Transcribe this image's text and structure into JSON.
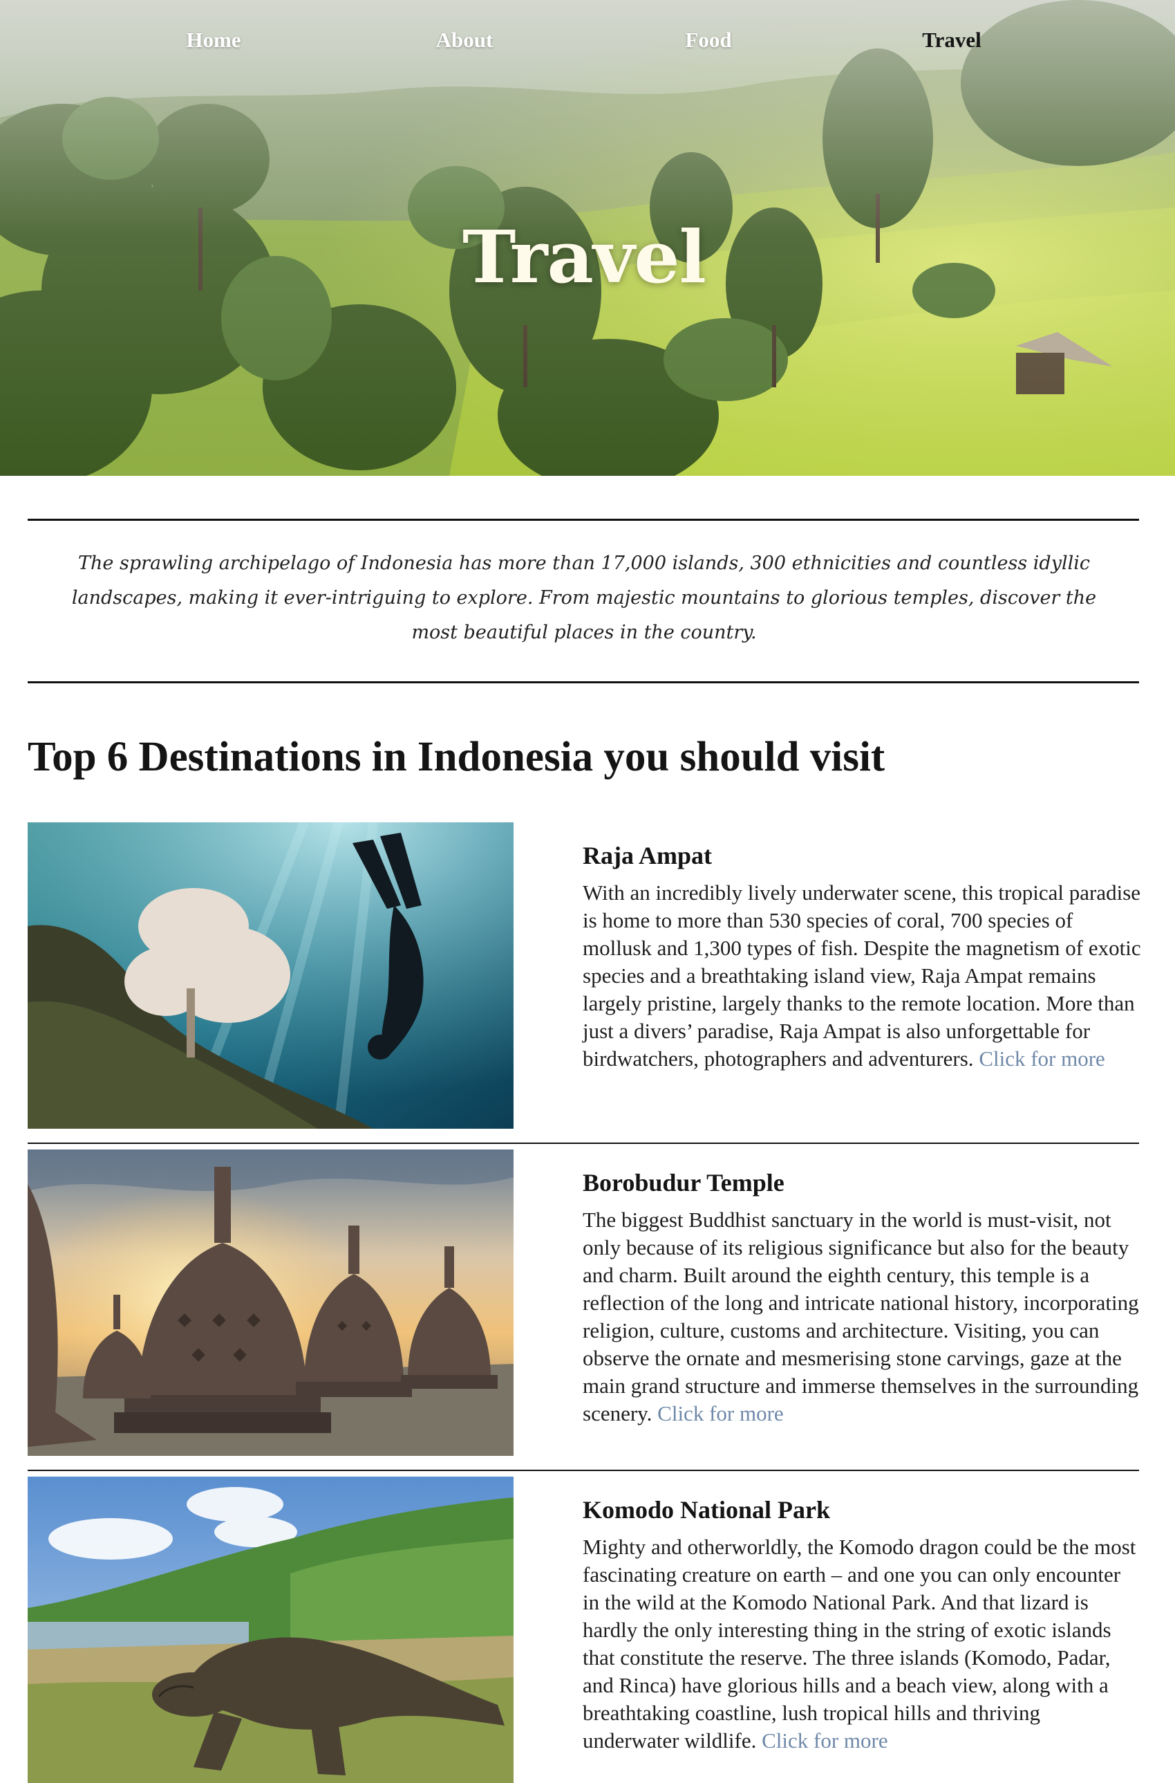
{
  "nav": {
    "items": [
      {
        "label": "Home",
        "active": false
      },
      {
        "label": "About",
        "active": false
      },
      {
        "label": "Food",
        "active": false
      },
      {
        "label": "Travel",
        "active": true
      }
    ]
  },
  "hero": {
    "title": "Travel"
  },
  "intro": {
    "text": "The sprawling archipelago of Indonesia has more than 17,000 islands, 300 ethnicities and countless idyllic landscapes, making it ever-intriguing to explore. From majestic mountains to glorious temples, discover the most beautiful places in the country."
  },
  "section": {
    "heading": "Top 6 Destinations in Indonesia you should visit"
  },
  "destinations": [
    {
      "title": "Raja Ampat",
      "body": "With an incredibly lively underwater scene, this tropical paradise is home to more than 530 species of coral, 700 species of mollusk and 1,300 types of fish. Despite the magnetism of exotic species and a breathtaking island view, Raja Ampat remains largely pristine, largely thanks to the remote location. More than just a divers’ paradise, Raja Ampat is also unforgettable for birdwatchers, photographers and adventurers.",
      "link": "Click for more"
    },
    {
      "title": "Borobudur Temple",
      "body": "The biggest Buddhist sanctuary in the world is must-visit, not only because of its religious significance but also for the beauty and charm. Built around the eighth century, this temple is a reflection of the long and intricate national history, incorporating religion, culture, customs and architecture. Visiting, you can observe the ornate and mesmerising stone carvings, gaze at the main grand structure and immerse themselves in the surrounding scenery.",
      "link": "Click for more"
    },
    {
      "title": "Komodo National Park",
      "body": "Mighty and otherworldly, the Komodo dragon could be the most fascinating creature on earth – and one you can only encounter in the wild at the Komodo National Park. And that lizard is hardly the only interesting thing in the string of exotic islands that constitute the reserve. The three islands (Komodo, Padar, and Rinca) have glorious hills and a beach view, along with a breathtaking coastline, lush tropical hills and thriving underwater wildlife.",
      "link": "Click for more"
    }
  ],
  "colors": {
    "link": "#6e88a8",
    "nav_active": "#141414",
    "nav_inactive": "#ffffff",
    "divider": "#111111"
  }
}
